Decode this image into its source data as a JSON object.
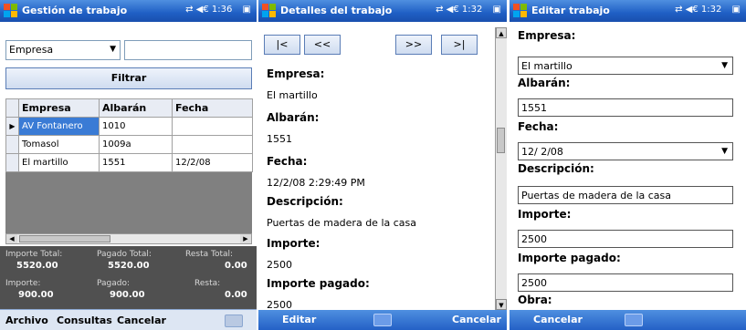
{
  "screen1": {
    "title": "Gestión de trabajo",
    "time": "1:36",
    "filter_combo": "Empresa",
    "filter_text": "",
    "filter_button": "Filtrar",
    "grid": {
      "headers": [
        "Empresa",
        "Albarán",
        "Fecha"
      ],
      "rows": [
        [
          "AV Fontanero",
          "1010",
          ""
        ],
        [
          "Tomasol",
          "1009a",
          ""
        ],
        [
          "El martillo",
          "1551",
          "12/2/08"
        ]
      ]
    },
    "totals": {
      "importe_total_label": "Importe Total:",
      "importe_total": "5520.00",
      "pagado_total_label": "Pagado Total:",
      "pagado_total": "5520.00",
      "resta_total_label": "Resta Total:",
      "resta_total": "0.00",
      "importe_label": "Importe:",
      "importe": "900.00",
      "pagado_label": "Pagado:",
      "pagado": "900.00",
      "resta_label": "Resta:",
      "resta": "0.00"
    },
    "menu": [
      "Archivo",
      "Consultas",
      "Cancelar"
    ]
  },
  "screen2": {
    "title": "Detalles del trabajo",
    "time": "1:32",
    "nav": [
      "|<",
      "<<",
      ">>",
      ">|"
    ],
    "fields": [
      {
        "label": "Empresa:",
        "value": "El martillo"
      },
      {
        "label": "Albarán:",
        "value": "1551"
      },
      {
        "label": "Fecha:",
        "value": "12/2/08 2:29:49 PM"
      },
      {
        "label": "Descripción:",
        "value": "Puertas de madera de la casa"
      },
      {
        "label": "Importe:",
        "value": "2500"
      },
      {
        "label": "Importe pagado:",
        "value": "2500"
      }
    ],
    "left_softkey": "Editar",
    "right_softkey": "Cancelar"
  },
  "screen3": {
    "title": "Editar trabajo",
    "time": "1:32",
    "empresa_label": "Empresa:",
    "empresa_value": "El martillo",
    "albaran_label": "Albarán:",
    "albaran_value": "1551",
    "fecha_label": "Fecha:",
    "fecha_value": "12/ 2/08",
    "descripcion_label": "Descripción:",
    "descripcion_value": "Puertas de madera de la casa",
    "importe_label": "Importe:",
    "importe_value": "2500",
    "importe_pagado_label": "Importe pagado:",
    "importe_pagado_value": "2500",
    "obra_label": "Obra:",
    "left_softkey": "Cancelar"
  },
  "colors": {
    "titlebar": "#1f5fc4",
    "selection": "#3a7bd5",
    "totals_bg": "#505050"
  },
  "icons": [
    "windows-logo-icon",
    "connectivity-icon",
    "volume-icon",
    "ok-icon",
    "keyboard-icon"
  ]
}
